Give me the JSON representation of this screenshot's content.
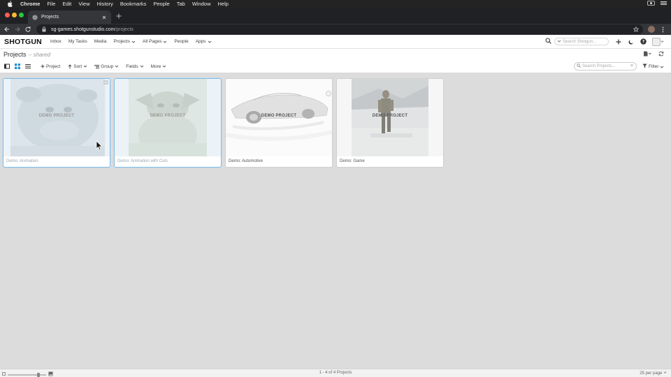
{
  "menubar": {
    "app": "Chrome",
    "items": [
      "File",
      "Edit",
      "View",
      "History",
      "Bookmarks",
      "People",
      "Tab",
      "Window",
      "Help"
    ]
  },
  "browser": {
    "tab_title": "Projects",
    "url_host": "sg-games.shotgunstudio.com",
    "url_path": "/projects"
  },
  "header": {
    "logo": "SHOTGUN",
    "nav": [
      {
        "label": "Inbox",
        "dropdown": false
      },
      {
        "label": "My Tasks",
        "dropdown": false
      },
      {
        "label": "Media",
        "dropdown": false
      },
      {
        "label": "Projects",
        "dropdown": true
      },
      {
        "label": "All Pages",
        "dropdown": true
      },
      {
        "label": "People",
        "dropdown": false
      },
      {
        "label": "Apps",
        "dropdown": true
      }
    ],
    "search_placeholder": "Search Shotgun..."
  },
  "page": {
    "title": "Projects",
    "subtitle": "-- shared"
  },
  "toolbar": {
    "project_label": "Project",
    "sort_label": "Sort",
    "group_label": "Group",
    "fields_label": "Fields",
    "more_label": "More",
    "search_placeholder": "Search Projects...",
    "filter_label": "Filter"
  },
  "cards": [
    {
      "label": "DEMO PROJECT",
      "name": "Demo: Animation",
      "image": "animation-character",
      "selected": true
    },
    {
      "label": "DEMO PROJECT",
      "name": "Demo: Animation with Cuts",
      "image": "animation-character-cuts",
      "selected": true
    },
    {
      "label": "DEMO PROJECT",
      "name": "Demo: Automotive",
      "image": "car-sketch",
      "selected": false
    },
    {
      "label": "DEMO PROJECT",
      "name": "Demo: Game",
      "image": "game-soldier",
      "selected": false
    }
  ],
  "footer": {
    "count": "1 - 4 of 4 Projects",
    "per_page": "25 per page"
  },
  "colors": {
    "selected_border": "#86b9dd",
    "background": "#dcdcdc",
    "chrome_dark": "#202124"
  }
}
